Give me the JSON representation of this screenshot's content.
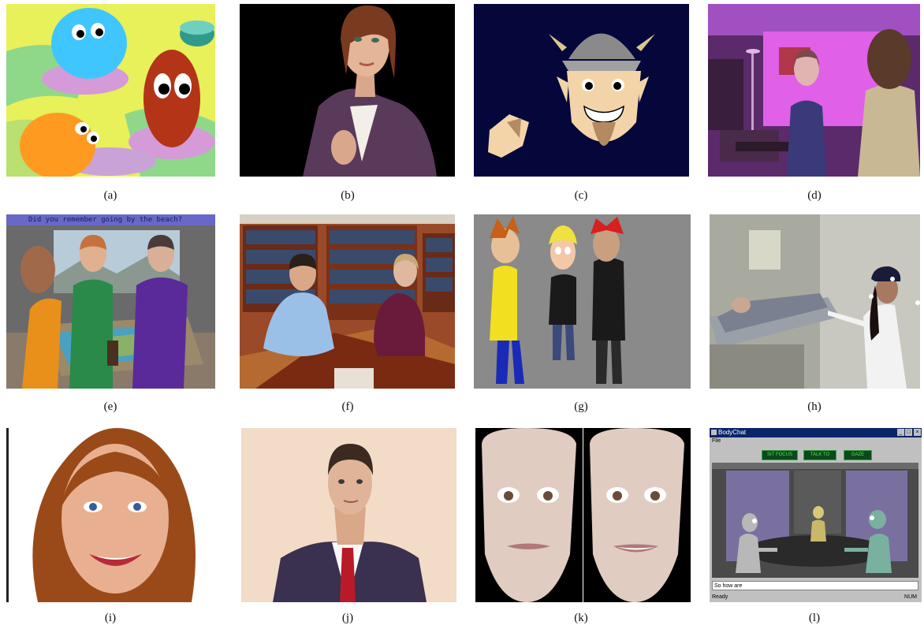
{
  "figure": {
    "captions": [
      "(a)",
      "(b)",
      "(c)",
      "(d)",
      "(e)",
      "(f)",
      "(g)",
      "(h)",
      "(i)",
      "(j)",
      "(k)",
      "(l)"
    ],
    "panel_e_overlay_text": "Did you remember going by the beach?"
  },
  "bodychat_window": {
    "title": "BodyChat",
    "menu_file": "File",
    "buttons": [
      "SIT FOCUS",
      "TALK TO",
      "GAZE"
    ],
    "chat_input_value": "So how are",
    "status_ready": "Ready",
    "status_num": "NUM",
    "icons": {
      "minimize": "minimize-icon",
      "maximize": "maximize-icon",
      "close": "close-icon"
    }
  }
}
